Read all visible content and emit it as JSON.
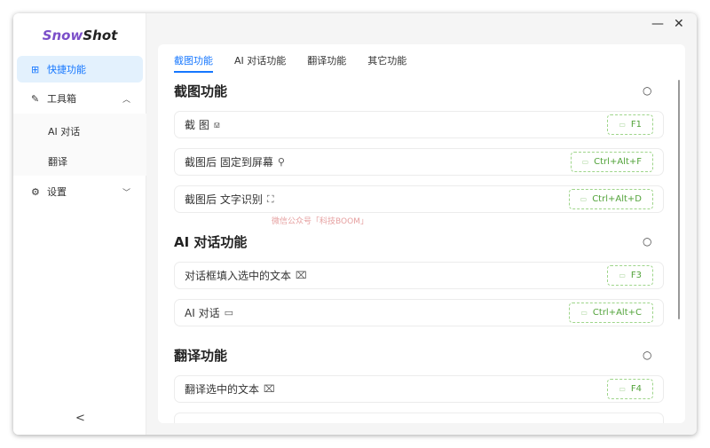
{
  "app": {
    "logo_a": "Snow",
    "logo_b": "Shot",
    "minimize": "—",
    "close": "✕"
  },
  "sidebar": {
    "items": [
      {
        "label": "快捷功能",
        "icon": "grid-icon"
      },
      {
        "label": "工具箱",
        "icon": "wrench-icon"
      },
      {
        "label": "设置",
        "icon": "gear-icon"
      }
    ],
    "subitems": [
      "AI 对话",
      "翻译"
    ],
    "collapse": "<"
  },
  "tabs": [
    "截图功能",
    "AI 对话功能",
    "翻译功能",
    "其它功能"
  ],
  "sections": [
    {
      "title": "截图功能",
      "rows": [
        {
          "label": "截 图",
          "icon": "⟏",
          "key": "F1"
        },
        {
          "label": "截图后 固定到屏幕",
          "icon": "⚲",
          "key": "Ctrl+Alt+F"
        },
        {
          "label": "截图后 文字识别",
          "icon": "⛶",
          "key": "Ctrl+Alt+D"
        }
      ]
    },
    {
      "title": "AI 对话功能",
      "rows": [
        {
          "label": "对话框填入选中的文本",
          "icon": "⌧",
          "key": "F3"
        },
        {
          "label": "AI 对话",
          "icon": "▭",
          "key": "Ctrl+Alt+C"
        }
      ]
    },
    {
      "title": "翻译功能",
      "rows": [
        {
          "label": "翻译选中的文本",
          "icon": "⌧",
          "key": "F4"
        }
      ]
    }
  ],
  "watermark": "微信公众号「科技BOOM」",
  "colors": {
    "accent": "#1677ff",
    "key": "#52a33a"
  }
}
